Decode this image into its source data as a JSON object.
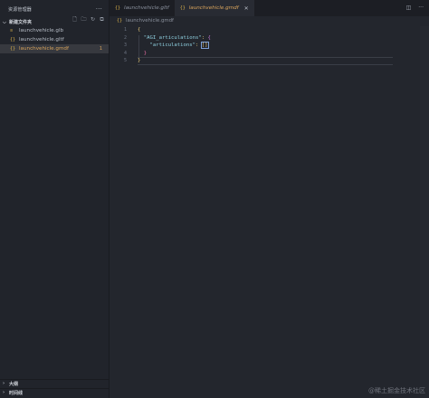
{
  "explorer": {
    "title": "资源管理器",
    "more_icon": "more-icon",
    "folder_name": "新建文件夹",
    "files": [
      {
        "name": "launchvehicle.glb",
        "icon": "file-icon"
      },
      {
        "name": "launchvehicle.gltf",
        "icon": "json-icon"
      },
      {
        "name": "launchvehicle.gmdf",
        "icon": "json-icon",
        "badge": "1"
      }
    ],
    "outline": "大纲",
    "timeline": "时间线"
  },
  "tabs": [
    {
      "label": "launchvehicle.gltf"
    },
    {
      "label": "launchvehicle.gmdf"
    }
  ],
  "breadcrumb": "launchvehicle.gmdf",
  "code": {
    "line_numbers": [
      "1",
      "2",
      "3",
      "4",
      "5"
    ],
    "key1": "\"AGI_articulations\"",
    "key2": "\"articulations\"",
    "bracket": "[]"
  },
  "colors": {
    "accent": "#d9a45c",
    "brace": "#d8b04a"
  },
  "watermark": "@稀土掘金技术社区"
}
